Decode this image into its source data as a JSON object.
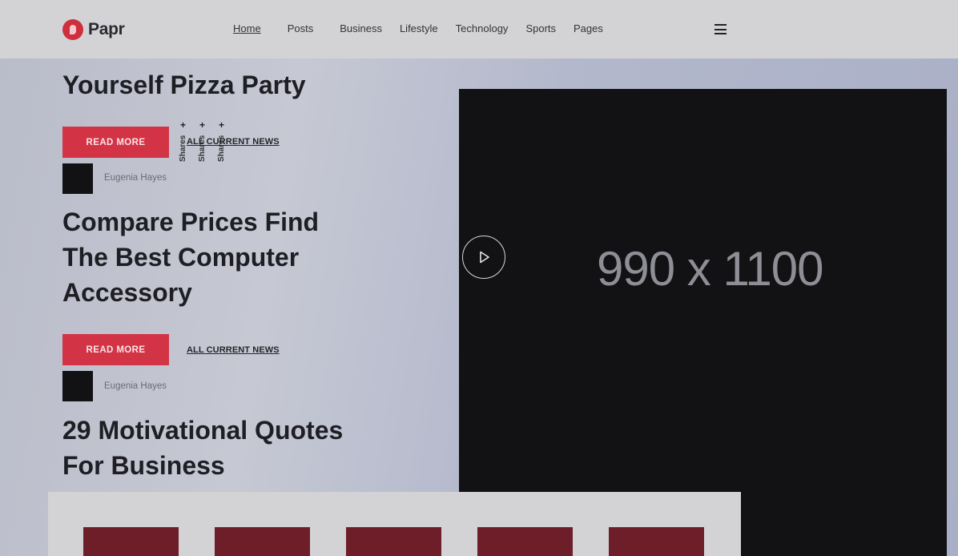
{
  "header": {
    "logo_text": "Papr",
    "nav": [
      {
        "label": "Home",
        "active": true
      },
      {
        "label": "Posts"
      },
      {
        "label": "Business"
      },
      {
        "label": "Lifestyle"
      },
      {
        "label": "Technology"
      },
      {
        "label": "Sports"
      },
      {
        "label": "Pages"
      }
    ],
    "menu_icon": "hamburger-icon"
  },
  "articles": [
    {
      "title": "Yourself Pizza Party",
      "read_more": "READ MORE",
      "category_link": "ALL CURRENT NEWS",
      "author": "Eugenia Hayes"
    },
    {
      "title": "Compare Prices Find The Best Computer Accessory",
      "read_more": "READ MORE",
      "category_link": "ALL CURRENT NEWS",
      "author": "Eugenia Hayes"
    },
    {
      "title": "29 Motivational Quotes For Business"
    }
  ],
  "shares": [
    {
      "plus": "+",
      "label": "Shares"
    },
    {
      "plus": "+",
      "label": "Shares"
    },
    {
      "plus": "+",
      "label": "Shares"
    }
  ],
  "video": {
    "placeholder_label": "990 x 1100",
    "play_icon": "play-icon"
  },
  "colors": {
    "accent": "#d23445",
    "header_bg": "#d3d3d6",
    "video_bg": "#121214",
    "tile": "#6e1e28"
  }
}
